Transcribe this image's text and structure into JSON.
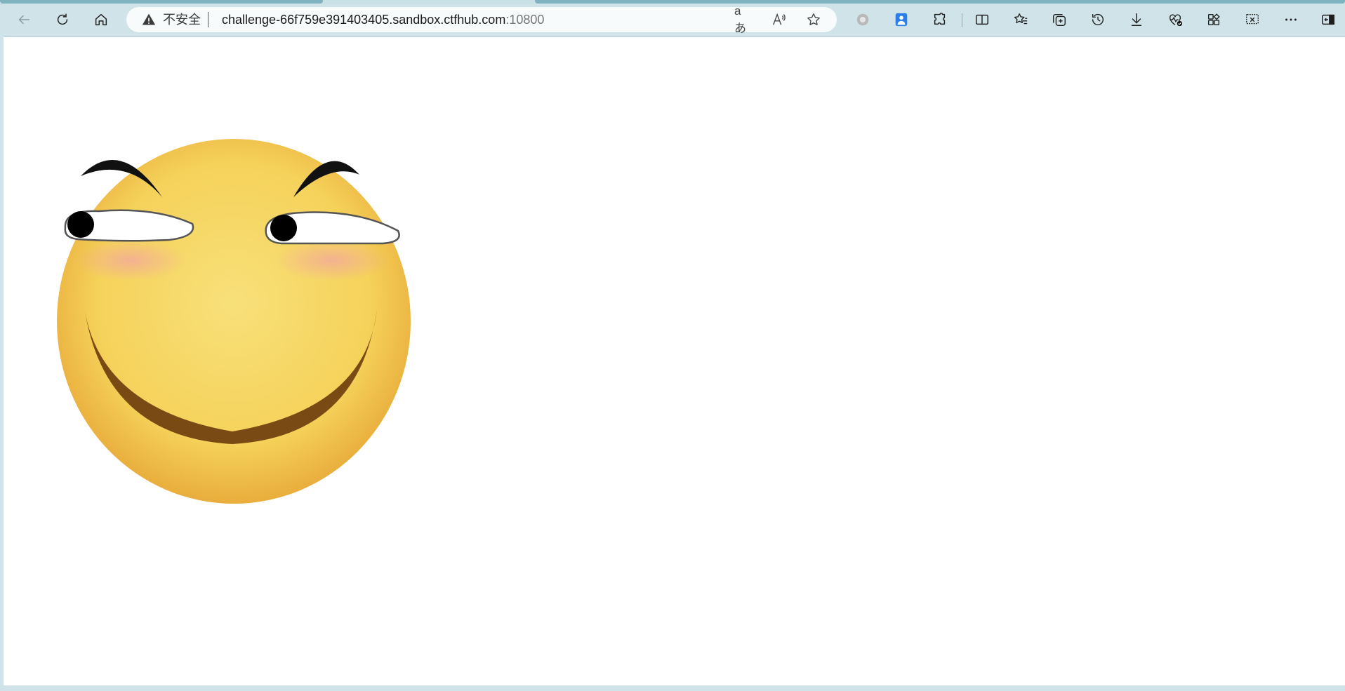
{
  "browser": {
    "security_label": "不安全",
    "url_host": "challenge-66f759e391403405.sandbox.ctfhub.com",
    "url_port": ":10800",
    "translate_label": "aあ",
    "read_aloud_label": "A"
  },
  "toolbar": {
    "icons": [
      "back-icon",
      "refresh-icon",
      "home-icon",
      "extension-icon",
      "profile-icon",
      "puzzle-icon",
      "split-screen-icon",
      "favorites-icon",
      "collections-icon",
      "history-icon",
      "download-icon",
      "performance-icon",
      "apps-icon",
      "screenshot-icon",
      "more-icon",
      "sidebar-icon"
    ]
  },
  "page": {
    "image": "smiley-face",
    "colors": {
      "face": "#f6d35c",
      "face_edge": "#edb940",
      "blush": "#f2a6a0",
      "mouth": "#7a4a14"
    }
  }
}
